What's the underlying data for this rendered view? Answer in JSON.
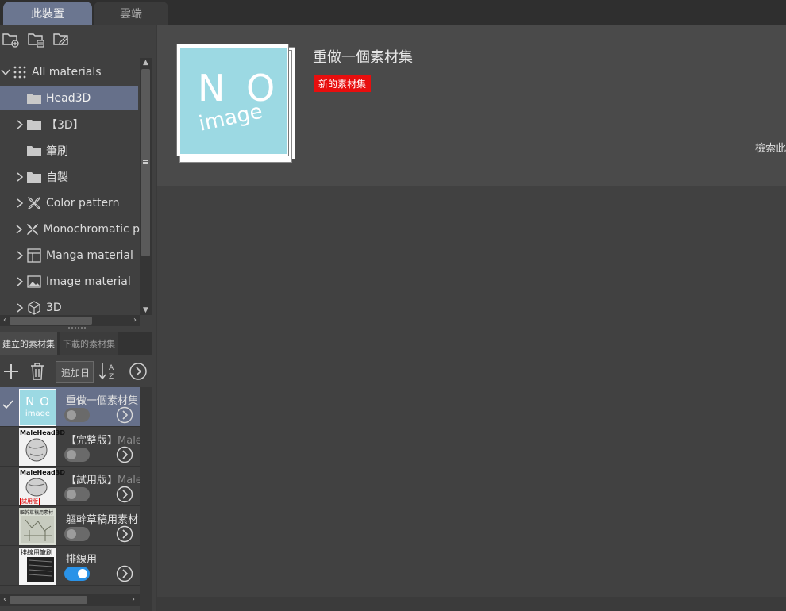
{
  "tabs": {
    "local": "此裝置",
    "cloud": "雲端"
  },
  "tree": {
    "items": [
      {
        "label": "All materials",
        "icon": "grid-icon"
      },
      {
        "label": "Head3D",
        "icon": "folder-icon"
      },
      {
        "label": "【3D】",
        "icon": "folder-icon"
      },
      {
        "label": "筆刷",
        "icon": "folder-icon"
      },
      {
        "label": "自製",
        "icon": "folder-icon"
      },
      {
        "label": "Color pattern",
        "icon": "pattern-icon"
      },
      {
        "label": "Monochromatic p",
        "icon": "pattern-icon"
      },
      {
        "label": "Manga material",
        "icon": "manga-icon"
      },
      {
        "label": "Image material",
        "icon": "image-icon"
      },
      {
        "label": "3D",
        "icon": "cube-icon"
      }
    ]
  },
  "subtabs": {
    "created": "建立的素材集",
    "downloaded": "下載的素材集"
  },
  "set_toolbar": {
    "sort_label": "追加日"
  },
  "sets": [
    {
      "name": "重做一個素材集",
      "name_dim": "",
      "enabled": false,
      "checked": true,
      "thumb": "noimage"
    },
    {
      "name": "【完整版】",
      "name_dim": "MaleH",
      "enabled": false,
      "checked": false,
      "thumb": "malehead"
    },
    {
      "name": "【試用版】",
      "name_dim": "MaleH",
      "enabled": false,
      "checked": false,
      "thumb": "malehead-trial"
    },
    {
      "name": "軀幹草稿用素材",
      "name_dim": "",
      "enabled": false,
      "checked": false,
      "thumb": "torso"
    },
    {
      "name": "排線用",
      "name_dim": "",
      "enabled": true,
      "checked": false,
      "thumb": "hatching"
    }
  ],
  "thumb_text": {
    "no": "N O",
    "image": "image",
    "malehead": "MaleHead3D",
    "trial": "試用版",
    "torso": "軀幹草稿用素材",
    "hatching": "排線用筆刷"
  },
  "detail": {
    "title": "重做一個素材集",
    "badge": "新的素材集",
    "search_label": "檢索此",
    "noimage_top": "N O",
    "noimage_bottom": "image"
  },
  "colors": {
    "accent": "#66708a",
    "badge": "#e80e0e",
    "toggle_on": "#2a93e8",
    "noimage_bg": "#9cd9e3"
  }
}
